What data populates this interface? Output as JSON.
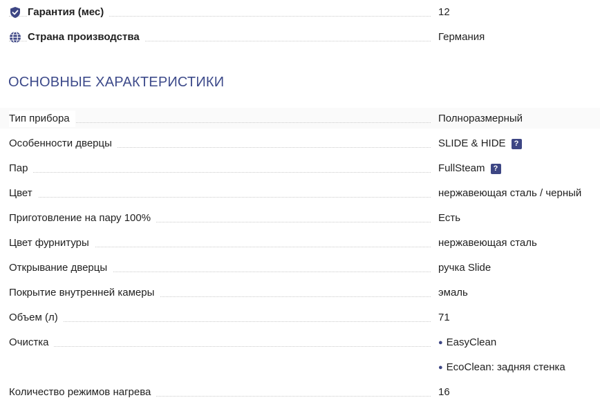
{
  "top_specs": [
    {
      "label": "Гарантия (мес)",
      "value": "12",
      "icon": "shield-check-icon"
    },
    {
      "label": "Страна производства",
      "value": "Германия",
      "icon": "globe-icon"
    }
  ],
  "section": {
    "title": "ОСНОВНЫЕ ХАРАКТЕРИСТИКИ"
  },
  "specs": [
    {
      "label": "Тип прибора",
      "value": "Полноразмерный"
    },
    {
      "label": "Особенности дверцы",
      "value": "SLIDE & HIDE",
      "help": "?"
    },
    {
      "label": "Пар",
      "value": "FullSteam",
      "help": "?"
    },
    {
      "label": "Цвет",
      "value": "нержавеющая сталь / черный"
    },
    {
      "label": "Приготовление на пару 100%",
      "value": "Есть"
    },
    {
      "label": "Цвет фурнитуры",
      "value": "нержавеющая сталь"
    },
    {
      "label": "Открывание дверцы",
      "value": "ручка Slide"
    },
    {
      "label": "Покрытие внутренней камеры",
      "value": "эмаль"
    },
    {
      "label": "Объем (л)",
      "value": "71"
    },
    {
      "label": "Очистка",
      "values": [
        "EasyClean",
        "EcoClean: задняя стенка"
      ]
    },
    {
      "label": "Количество режимов нагрева",
      "value": "16"
    }
  ],
  "colors": {
    "accent": "#3d4684",
    "title": "#3d4a8a"
  }
}
